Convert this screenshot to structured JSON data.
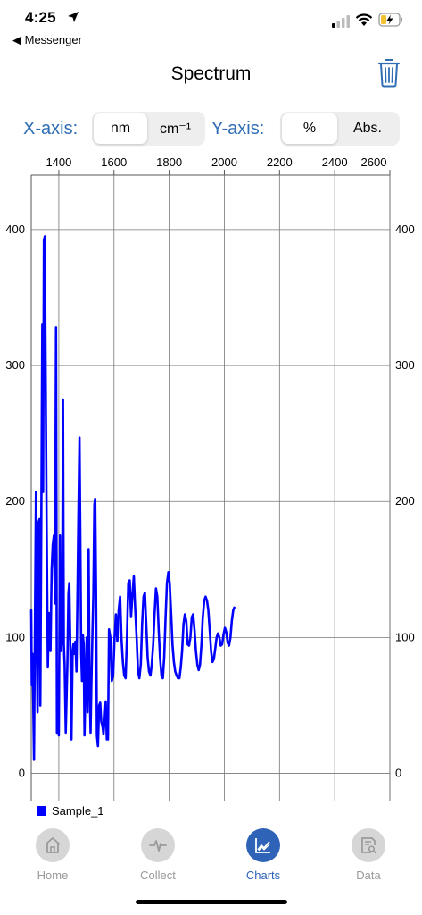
{
  "status_bar": {
    "time": "4:25",
    "back_app": "◀ Messenger"
  },
  "header": {
    "title": "Spectrum",
    "trash_icon": "trash-icon"
  },
  "controls": {
    "x_axis_label": "X-axis:",
    "x_options": [
      "nm",
      "cm⁻¹"
    ],
    "x_selected": "nm",
    "y_axis_label": "Y-axis:",
    "y_options": [
      "%",
      "Abs."
    ],
    "y_selected": "%"
  },
  "chart_data": {
    "type": "line",
    "title": "",
    "xlabel": "",
    "ylabel": "",
    "xlim": [
      1300,
      2600
    ],
    "ylim": [
      -20,
      440
    ],
    "x_ticks": [
      "1400",
      "1600",
      "1800",
      "2000",
      "2200",
      "2400",
      "2600"
    ],
    "y_ticks": [
      "0",
      "100",
      "200",
      "300",
      "400"
    ],
    "grid": true,
    "legend_position": "bottom-left",
    "series": [
      {
        "name": "Sample_1",
        "color": "#0000ff",
        "points": [
          [
            1300,
            120
          ],
          [
            1302,
            65
          ],
          [
            1305,
            88
          ],
          [
            1310,
            10
          ],
          [
            1314,
            120
          ],
          [
            1317,
            207
          ],
          [
            1320,
            100
          ],
          [
            1323,
            45
          ],
          [
            1327,
            185
          ],
          [
            1330,
            187
          ],
          [
            1333,
            50
          ],
          [
            1337,
            200
          ],
          [
            1340,
            330
          ],
          [
            1343,
            207
          ],
          [
            1346,
            392
          ],
          [
            1349,
            395
          ],
          [
            1352,
            300
          ],
          [
            1356,
            180
          ],
          [
            1360,
            78
          ],
          [
            1364,
            118
          ],
          [
            1370,
            90
          ],
          [
            1374,
            150
          ],
          [
            1378,
            168
          ],
          [
            1382,
            175
          ],
          [
            1386,
            125
          ],
          [
            1390,
            328
          ],
          [
            1393,
            30
          ],
          [
            1396,
            73
          ],
          [
            1400,
            28
          ],
          [
            1404,
            175
          ],
          [
            1406,
            90
          ],
          [
            1409,
            145
          ],
          [
            1412,
            95
          ],
          [
            1415,
            275
          ],
          [
            1418,
            95
          ],
          [
            1421,
            80
          ],
          [
            1425,
            30
          ],
          [
            1431,
            80
          ],
          [
            1435,
            132
          ],
          [
            1438,
            140
          ],
          [
            1442,
            90
          ],
          [
            1446,
            25
          ],
          [
            1450,
            90
          ],
          [
            1453,
            95
          ],
          [
            1456,
            88
          ],
          [
            1460,
            97
          ],
          [
            1464,
            75
          ],
          [
            1467,
            120
          ],
          [
            1471,
            190
          ],
          [
            1475,
            247
          ],
          [
            1478,
            175
          ],
          [
            1481,
            88
          ],
          [
            1484,
            68
          ],
          [
            1487,
            102
          ],
          [
            1490,
            95
          ],
          [
            1493,
            28
          ],
          [
            1497,
            68
          ],
          [
            1501,
            100
          ],
          [
            1504,
            45
          ],
          [
            1508,
            165
          ],
          [
            1511,
            75
          ],
          [
            1515,
            30
          ],
          [
            1518,
            65
          ],
          [
            1522,
            103
          ],
          [
            1525,
            130
          ],
          [
            1529,
            198
          ],
          [
            1532,
            202
          ],
          [
            1535,
            130
          ],
          [
            1538,
            28
          ],
          [
            1542,
            20
          ],
          [
            1546,
            50
          ],
          [
            1550,
            52
          ],
          [
            1554,
            38
          ],
          [
            1558,
            35
          ],
          [
            1562,
            29
          ],
          [
            1566,
            40
          ],
          [
            1570,
            53
          ],
          [
            1574,
            25
          ],
          [
            1578,
            25
          ],
          [
            1582,
            106
          ],
          [
            1587,
            100
          ],
          [
            1592,
            68
          ],
          [
            1597,
            72
          ],
          [
            1602,
            100
          ],
          [
            1607,
            117
          ],
          [
            1612,
            97
          ],
          [
            1617,
            120
          ],
          [
            1622,
            130
          ],
          [
            1627,
            100
          ],
          [
            1632,
            82
          ],
          [
            1637,
            72
          ],
          [
            1642,
            70
          ],
          [
            1647,
            100
          ],
          [
            1652,
            140
          ],
          [
            1657,
            142
          ],
          [
            1662,
            115
          ],
          [
            1667,
            132
          ],
          [
            1672,
            145
          ],
          [
            1677,
            120
          ],
          [
            1682,
            100
          ],
          [
            1687,
            75
          ],
          [
            1692,
            70
          ],
          [
            1697,
            80
          ],
          [
            1702,
            110
          ],
          [
            1707,
            130
          ],
          [
            1712,
            133
          ],
          [
            1717,
            110
          ],
          [
            1722,
            85
          ],
          [
            1727,
            75
          ],
          [
            1732,
            72
          ],
          [
            1737,
            80
          ],
          [
            1742,
            95
          ],
          [
            1747,
            117
          ],
          [
            1752,
            136
          ],
          [
            1757,
            130
          ],
          [
            1762,
            105
          ],
          [
            1767,
            85
          ],
          [
            1772,
            72
          ],
          [
            1777,
            70
          ],
          [
            1782,
            85
          ],
          [
            1787,
            115
          ],
          [
            1792,
            140
          ],
          [
            1797,
            148
          ],
          [
            1802,
            140
          ],
          [
            1807,
            118
          ],
          [
            1812,
            95
          ],
          [
            1817,
            82
          ],
          [
            1822,
            75
          ],
          [
            1827,
            72
          ],
          [
            1832,
            70
          ],
          [
            1837,
            70
          ],
          [
            1842,
            78
          ],
          [
            1847,
            90
          ],
          [
            1852,
            110
          ],
          [
            1857,
            117
          ],
          [
            1862,
            112
          ],
          [
            1867,
            95
          ],
          [
            1872,
            94
          ],
          [
            1877,
            100
          ],
          [
            1882,
            115
          ],
          [
            1887,
            117
          ],
          [
            1892,
            105
          ],
          [
            1897,
            90
          ],
          [
            1902,
            80
          ],
          [
            1907,
            76
          ],
          [
            1912,
            80
          ],
          [
            1917,
            95
          ],
          [
            1922,
            115
          ],
          [
            1927,
            127
          ],
          [
            1932,
            130
          ],
          [
            1937,
            127
          ],
          [
            1942,
            120
          ],
          [
            1947,
            105
          ],
          [
            1952,
            90
          ],
          [
            1957,
            82
          ],
          [
            1962,
            84
          ],
          [
            1967,
            92
          ],
          [
            1972,
            100
          ],
          [
            1977,
            103
          ],
          [
            1982,
            100
          ],
          [
            1987,
            94
          ],
          [
            1992,
            95
          ],
          [
            1997,
            102
          ],
          [
            2002,
            107
          ],
          [
            2007,
            104
          ],
          [
            2012,
            96
          ],
          [
            2017,
            94
          ],
          [
            2022,
            100
          ],
          [
            2027,
            112
          ],
          [
            2032,
            120
          ],
          [
            2036,
            122
          ]
        ]
      }
    ]
  },
  "tabs": [
    {
      "label": "Home",
      "icon": "home-icon",
      "active": false
    },
    {
      "label": "Collect",
      "icon": "pulse-icon",
      "active": false
    },
    {
      "label": "Charts",
      "icon": "line-chart-icon",
      "active": true
    },
    {
      "label": "Data",
      "icon": "document-search-icon",
      "active": false
    }
  ],
  "colors": {
    "accent": "#2f6db5",
    "tab_active": "#2e63b8",
    "tab_inactive": "#9a9a9a",
    "series": "#0000ff"
  }
}
